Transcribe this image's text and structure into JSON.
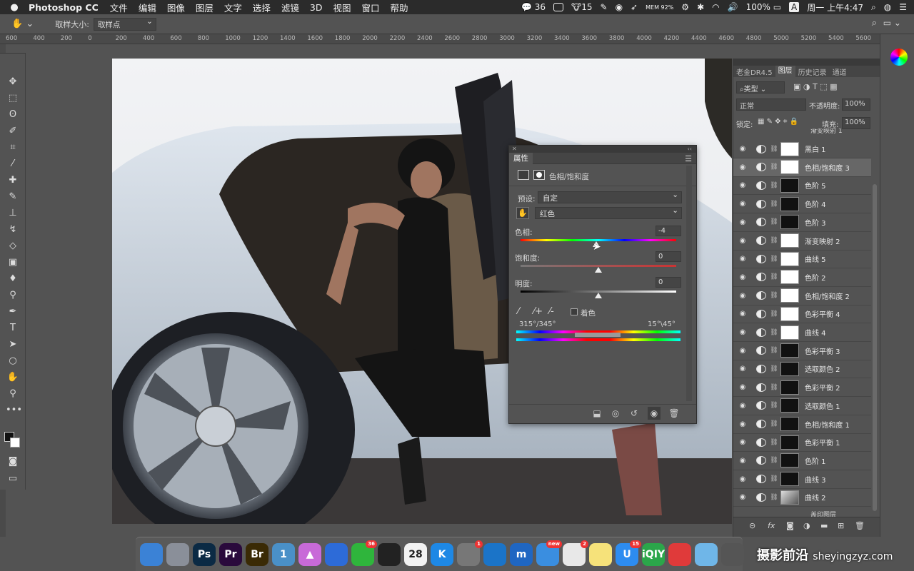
{
  "menubar": {
    "app_name": "Photoshop CC",
    "items": [
      "文件",
      "编辑",
      "图像",
      "图层",
      "文字",
      "选择",
      "滤镜",
      "3D",
      "视图",
      "窗口",
      "帮助"
    ],
    "wechat_count": "36",
    "badge_15": "15",
    "memory": "MEM 92%",
    "battery": "100%",
    "input_method": "A",
    "clock": "周一 上午4:47"
  },
  "options_bar": {
    "sample_size_label": "取样大小:",
    "sample_size_value": "取样点"
  },
  "ruler": {
    "ticks": [
      "600",
      "400",
      "200",
      "0",
      "200",
      "400",
      "600",
      "800",
      "1000",
      "1200",
      "1400",
      "1600",
      "1800",
      "2000",
      "2200",
      "2400",
      "2600",
      "2800",
      "3000",
      "3200",
      "3400",
      "3600",
      "3800",
      "4000",
      "4200",
      "4400",
      "4600",
      "4800",
      "5000",
      "5200",
      "5400",
      "5600"
    ]
  },
  "properties_panel": {
    "tab_title": "属性",
    "adjustment_name": "色相/饱和度",
    "preset_label": "预设:",
    "preset_value": "自定",
    "channel_value": "红色",
    "hue_label": "色相:",
    "hue_value": "-4",
    "saturation_label": "饱和度:",
    "saturation_value": "0",
    "lightness_label": "明度:",
    "lightness_value": "0",
    "colorize_label": "着色",
    "range_left": "315°/345°",
    "range_right": "15°\\45°"
  },
  "layers_panel": {
    "tabs": [
      "老金DR4.5",
      "图层",
      "历史记录",
      "通道"
    ],
    "active_tab": "图层",
    "filter_kind": "类型",
    "blend_mode": "正常",
    "opacity_label": "不透明度:",
    "opacity_value": "100%",
    "lock_label": "锁定:",
    "fill_label": "填充:",
    "fill_value": "100%",
    "top_partial_layer": "渐变映射 1",
    "layers": [
      {
        "name": "黑白 1",
        "mask": "light"
      },
      {
        "name": "色相/饱和度 3",
        "mask": "light",
        "selected": true
      },
      {
        "name": "色阶 5",
        "mask": "dark"
      },
      {
        "name": "色阶 4",
        "mask": "dark"
      },
      {
        "name": "色阶 3",
        "mask": "dark"
      },
      {
        "name": "渐变映射 2",
        "mask": "light"
      },
      {
        "name": "曲线 5",
        "mask": "light"
      },
      {
        "name": "色阶 2",
        "mask": "light"
      },
      {
        "name": "色相/饱和度 2",
        "mask": "light"
      },
      {
        "name": "色彩平衡 4",
        "mask": "light"
      },
      {
        "name": "曲线 4",
        "mask": "light"
      },
      {
        "name": "色彩平衡 3",
        "mask": "dark"
      },
      {
        "name": "选取颜色 2",
        "mask": "dark"
      },
      {
        "name": "色彩平衡 2",
        "mask": "dark"
      },
      {
        "name": "选取颜色 1",
        "mask": "dark"
      },
      {
        "name": "色相/饱和度 1",
        "mask": "dark"
      },
      {
        "name": "色彩平衡 1",
        "mask": "dark"
      },
      {
        "name": "色阶 1",
        "mask": "dark"
      },
      {
        "name": "曲线 3",
        "mask": "dark"
      },
      {
        "name": "曲线 2",
        "mask": "photo"
      }
    ],
    "bottom_partial_layer": "盖印图层"
  },
  "dock": {
    "apps": [
      {
        "label": "",
        "color": "#3b82d6",
        "name": "finder-icon"
      },
      {
        "label": "",
        "color": "#8a8f99",
        "name": "launchpad-icon"
      },
      {
        "label": "Ps",
        "color": "#0b2a44",
        "name": "photoshop-icon"
      },
      {
        "label": "Pr",
        "color": "#2a0a3c",
        "name": "premiere-icon"
      },
      {
        "label": "Br",
        "color": "#3a2a05",
        "name": "bridge-icon"
      },
      {
        "label": "1",
        "color": "#4a90c8",
        "name": "1password-icon"
      },
      {
        "label": "▲",
        "color": "#c86ad8",
        "name": "prism-icon"
      },
      {
        "label": "",
        "color": "#2d6bd8",
        "name": "baidu-cloud-icon"
      },
      {
        "label": "",
        "color": "#2fb53c",
        "name": "wechat-icon",
        "badge": "36"
      },
      {
        "label": "",
        "color": "#222222",
        "name": "qq-icon"
      },
      {
        "label": "28",
        "color": "#f2f2f2",
        "name": "calendar-icon"
      },
      {
        "label": "K",
        "color": "#1e88e5",
        "name": "keynote-icon"
      },
      {
        "label": "",
        "color": "#777777",
        "name": "system-preferences-icon",
        "badge": "1"
      },
      {
        "label": "",
        "color": "#1b74c8",
        "name": "browser-icon"
      },
      {
        "label": "m",
        "color": "#1f66c2",
        "name": "mweb-icon"
      },
      {
        "label": "",
        "color": "#3a8ee0",
        "name": "mail-icon",
        "badge": "new"
      },
      {
        "label": "",
        "color": "#e8e8e8",
        "name": "chrome-icon",
        "badge": "2"
      },
      {
        "label": "",
        "color": "#f6e27a",
        "name": "notes-icon"
      },
      {
        "label": "U",
        "color": "#2d8cf0",
        "name": "uc-icon",
        "badge": "15"
      },
      {
        "label": "iQIY",
        "color": "#2ba64a",
        "name": "iqiyi-icon"
      },
      {
        "label": "",
        "color": "#e03a3a",
        "name": "netease-music-icon"
      },
      {
        "label": "",
        "color": "#6fb6e8",
        "name": "misc-app-icon"
      },
      {
        "label": "",
        "color": "#555555",
        "name": "trash-icon"
      }
    ]
  },
  "watermark": {
    "text": "摄影前沿",
    "url": "sheyingzyz.com"
  }
}
